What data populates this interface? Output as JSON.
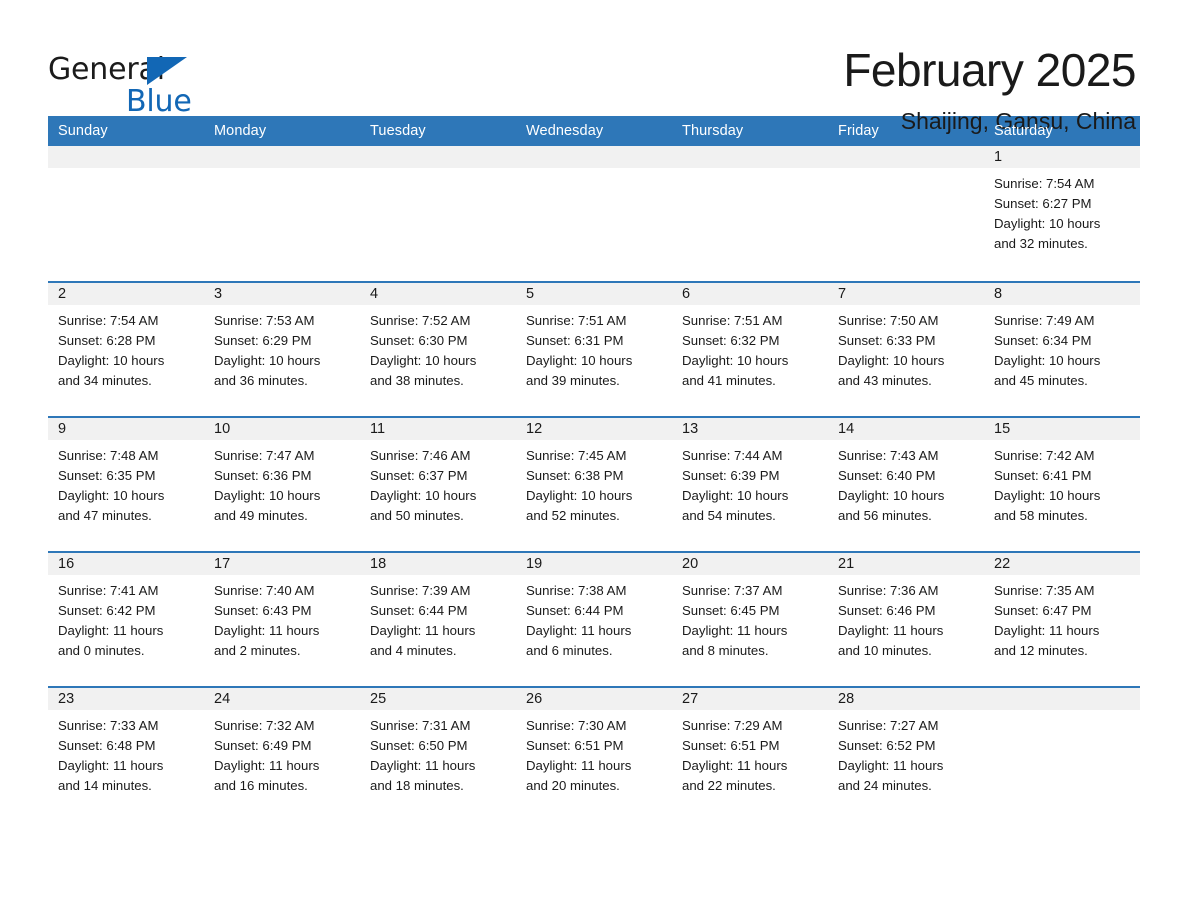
{
  "brand": {
    "word1": "General",
    "word2": "Blue",
    "accent_color": "#1267b5"
  },
  "header": {
    "month_title": "February 2025",
    "location": "Shaijing, Gansu, China"
  },
  "theme": {
    "header_blue": "#2e77b8",
    "day_head_gray": "#f1f1f1"
  },
  "weekdays": [
    "Sunday",
    "Monday",
    "Tuesday",
    "Wednesday",
    "Thursday",
    "Friday",
    "Saturday"
  ],
  "weeks": [
    [
      {
        "day": "",
        "lines": []
      },
      {
        "day": "",
        "lines": []
      },
      {
        "day": "",
        "lines": []
      },
      {
        "day": "",
        "lines": []
      },
      {
        "day": "",
        "lines": []
      },
      {
        "day": "",
        "lines": []
      },
      {
        "day": "1",
        "lines": [
          "Sunrise: 7:54 AM",
          "Sunset: 6:27 PM",
          "Daylight: 10 hours",
          "and 32 minutes."
        ]
      }
    ],
    [
      {
        "day": "2",
        "lines": [
          "Sunrise: 7:54 AM",
          "Sunset: 6:28 PM",
          "Daylight: 10 hours",
          "and 34 minutes."
        ]
      },
      {
        "day": "3",
        "lines": [
          "Sunrise: 7:53 AM",
          "Sunset: 6:29 PM",
          "Daylight: 10 hours",
          "and 36 minutes."
        ]
      },
      {
        "day": "4",
        "lines": [
          "Sunrise: 7:52 AM",
          "Sunset: 6:30 PM",
          "Daylight: 10 hours",
          "and 38 minutes."
        ]
      },
      {
        "day": "5",
        "lines": [
          "Sunrise: 7:51 AM",
          "Sunset: 6:31 PM",
          "Daylight: 10 hours",
          "and 39 minutes."
        ]
      },
      {
        "day": "6",
        "lines": [
          "Sunrise: 7:51 AM",
          "Sunset: 6:32 PM",
          "Daylight: 10 hours",
          "and 41 minutes."
        ]
      },
      {
        "day": "7",
        "lines": [
          "Sunrise: 7:50 AM",
          "Sunset: 6:33 PM",
          "Daylight: 10 hours",
          "and 43 minutes."
        ]
      },
      {
        "day": "8",
        "lines": [
          "Sunrise: 7:49 AM",
          "Sunset: 6:34 PM",
          "Daylight: 10 hours",
          "and 45 minutes."
        ]
      }
    ],
    [
      {
        "day": "9",
        "lines": [
          "Sunrise: 7:48 AM",
          "Sunset: 6:35 PM",
          "Daylight: 10 hours",
          "and 47 minutes."
        ]
      },
      {
        "day": "10",
        "lines": [
          "Sunrise: 7:47 AM",
          "Sunset: 6:36 PM",
          "Daylight: 10 hours",
          "and 49 minutes."
        ]
      },
      {
        "day": "11",
        "lines": [
          "Sunrise: 7:46 AM",
          "Sunset: 6:37 PM",
          "Daylight: 10 hours",
          "and 50 minutes."
        ]
      },
      {
        "day": "12",
        "lines": [
          "Sunrise: 7:45 AM",
          "Sunset: 6:38 PM",
          "Daylight: 10 hours",
          "and 52 minutes."
        ]
      },
      {
        "day": "13",
        "lines": [
          "Sunrise: 7:44 AM",
          "Sunset: 6:39 PM",
          "Daylight: 10 hours",
          "and 54 minutes."
        ]
      },
      {
        "day": "14",
        "lines": [
          "Sunrise: 7:43 AM",
          "Sunset: 6:40 PM",
          "Daylight: 10 hours",
          "and 56 minutes."
        ]
      },
      {
        "day": "15",
        "lines": [
          "Sunrise: 7:42 AM",
          "Sunset: 6:41 PM",
          "Daylight: 10 hours",
          "and 58 minutes."
        ]
      }
    ],
    [
      {
        "day": "16",
        "lines": [
          "Sunrise: 7:41 AM",
          "Sunset: 6:42 PM",
          "Daylight: 11 hours",
          "and 0 minutes."
        ]
      },
      {
        "day": "17",
        "lines": [
          "Sunrise: 7:40 AM",
          "Sunset: 6:43 PM",
          "Daylight: 11 hours",
          "and 2 minutes."
        ]
      },
      {
        "day": "18",
        "lines": [
          "Sunrise: 7:39 AM",
          "Sunset: 6:44 PM",
          "Daylight: 11 hours",
          "and 4 minutes."
        ]
      },
      {
        "day": "19",
        "lines": [
          "Sunrise: 7:38 AM",
          "Sunset: 6:44 PM",
          "Daylight: 11 hours",
          "and 6 minutes."
        ]
      },
      {
        "day": "20",
        "lines": [
          "Sunrise: 7:37 AM",
          "Sunset: 6:45 PM",
          "Daylight: 11 hours",
          "and 8 minutes."
        ]
      },
      {
        "day": "21",
        "lines": [
          "Sunrise: 7:36 AM",
          "Sunset: 6:46 PM",
          "Daylight: 11 hours",
          "and 10 minutes."
        ]
      },
      {
        "day": "22",
        "lines": [
          "Sunrise: 7:35 AM",
          "Sunset: 6:47 PM",
          "Daylight: 11 hours",
          "and 12 minutes."
        ]
      }
    ],
    [
      {
        "day": "23",
        "lines": [
          "Sunrise: 7:33 AM",
          "Sunset: 6:48 PM",
          "Daylight: 11 hours",
          "and 14 minutes."
        ]
      },
      {
        "day": "24",
        "lines": [
          "Sunrise: 7:32 AM",
          "Sunset: 6:49 PM",
          "Daylight: 11 hours",
          "and 16 minutes."
        ]
      },
      {
        "day": "25",
        "lines": [
          "Sunrise: 7:31 AM",
          "Sunset: 6:50 PM",
          "Daylight: 11 hours",
          "and 18 minutes."
        ]
      },
      {
        "day": "26",
        "lines": [
          "Sunrise: 7:30 AM",
          "Sunset: 6:51 PM",
          "Daylight: 11 hours",
          "and 20 minutes."
        ]
      },
      {
        "day": "27",
        "lines": [
          "Sunrise: 7:29 AM",
          "Sunset: 6:51 PM",
          "Daylight: 11 hours",
          "and 22 minutes."
        ]
      },
      {
        "day": "28",
        "lines": [
          "Sunrise: 7:27 AM",
          "Sunset: 6:52 PM",
          "Daylight: 11 hours",
          "and 24 minutes."
        ]
      },
      {
        "day": "",
        "lines": []
      }
    ]
  ]
}
